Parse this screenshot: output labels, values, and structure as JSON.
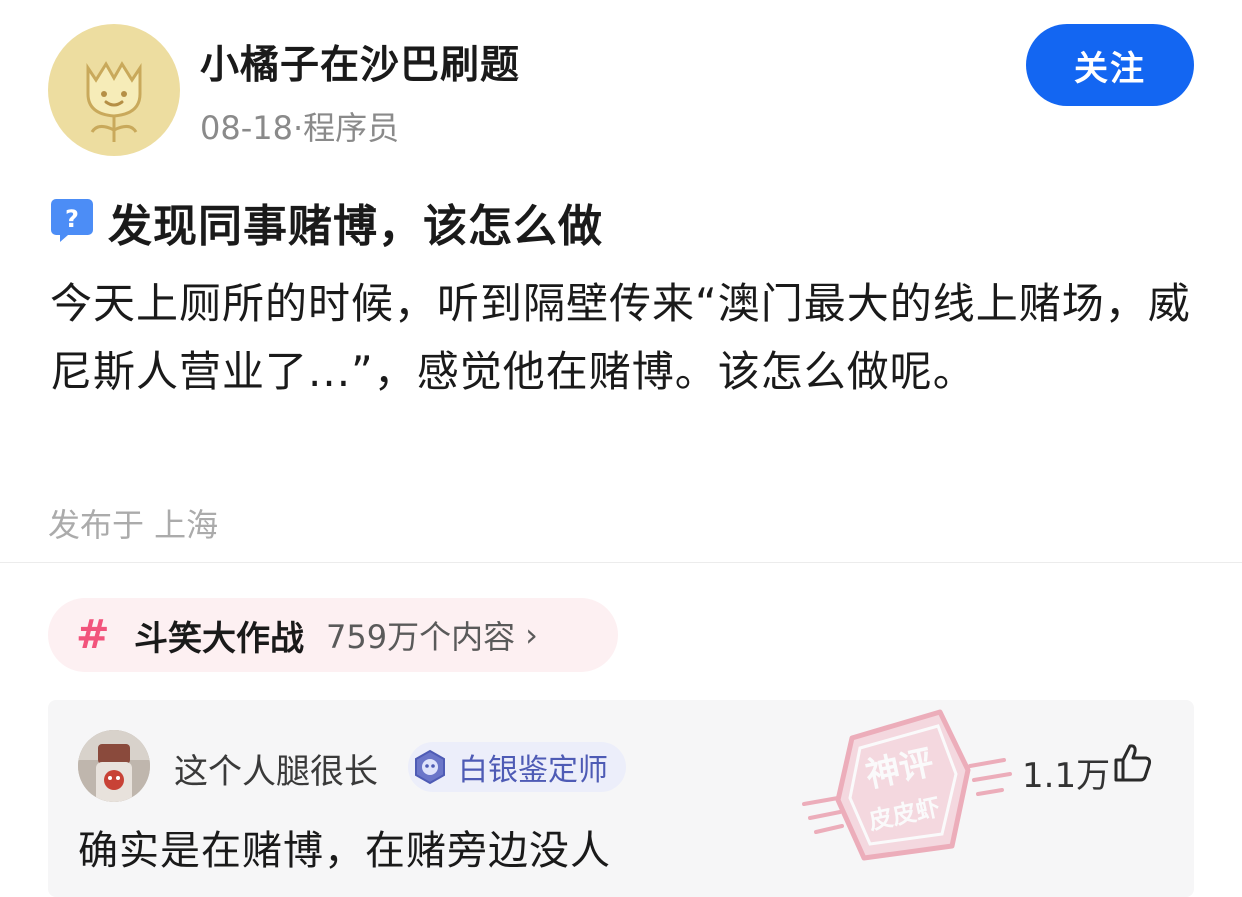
{
  "post": {
    "username": "小橘子在沙巴刷题",
    "date": "08-18",
    "separator": "·",
    "occupation": "程序员",
    "follow_label": "关注",
    "question_icon": "question-badge-icon",
    "title": "发现同事赌博，该怎么做",
    "body": "今天上厕所的时候，听到隔壁传来“澳门最大的线上赌场，威尼斯人营业了...”，感觉他在赌博。该怎么做呢。",
    "location": "发布于 上海"
  },
  "topic": {
    "hash": "#",
    "name": "斗笑大作战",
    "count": "759万个内容",
    "chevron": "›"
  },
  "comment": {
    "username": "这个人腿很长",
    "badge": "白银鉴定师",
    "text": "确实是在赌博，在赌旁边没人",
    "likes": "1.1万"
  },
  "watermark": {
    "line1": "神评",
    "line2": "皮皮虾"
  },
  "colors": {
    "accent": "#1366f2",
    "topic_pink": "#f2547c",
    "badge_blue": "#4e5bb5",
    "avatar_bg": "#eddda0"
  }
}
